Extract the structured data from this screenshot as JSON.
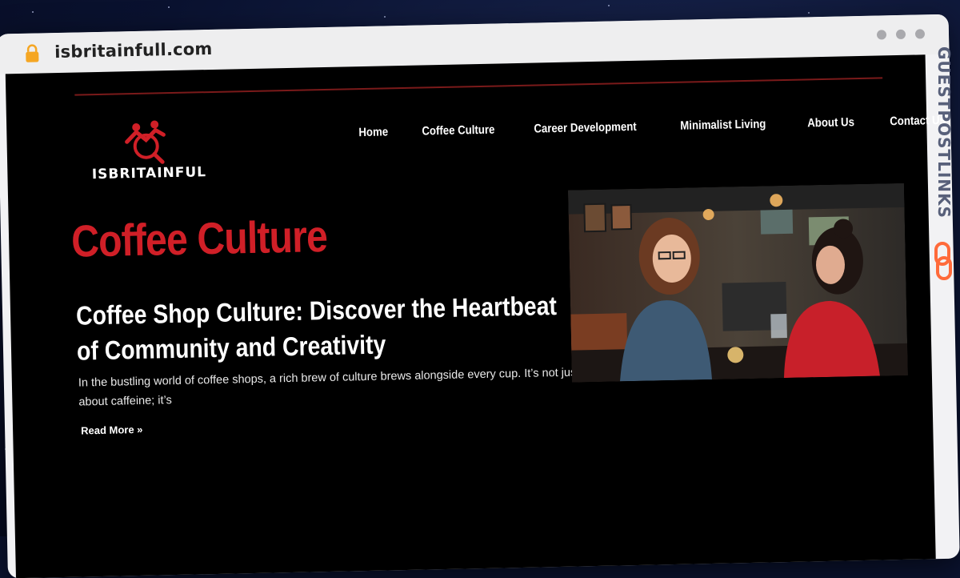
{
  "browser": {
    "url": "isbritainfull.com",
    "icons": {
      "lock": "lock-icon",
      "window_controls": "window-dots"
    }
  },
  "site": {
    "logo_text": "ISBRITAINFUL",
    "logo_icon": "people-search-logo",
    "nav": [
      {
        "label": "Home"
      },
      {
        "label": "Coffee Culture"
      },
      {
        "label": "Career Development"
      },
      {
        "label": "Minimalist Living"
      },
      {
        "label": "About Us"
      },
      {
        "label": "Contact Us"
      }
    ]
  },
  "main": {
    "category_title": "Coffee Culture",
    "post": {
      "title": "Coffee Shop Culture: Discover the Heartbeat of Community and Creativity",
      "excerpt": "In the bustling world of coffee shops, a rich brew of culture brews alongside every cup. It’s not just about caffeine; it’s",
      "read_more": "Read More »",
      "image": "coffee-shop-photo"
    }
  },
  "overlay": {
    "side_brand": "GUESTPOSTLINKS",
    "side_icon": "chain-link-icon"
  },
  "colors": {
    "accent": "#d01f27",
    "page_bg": "#000000",
    "chrome_bg": "#eeeeef",
    "brand_orange": "#ff6a3a"
  }
}
